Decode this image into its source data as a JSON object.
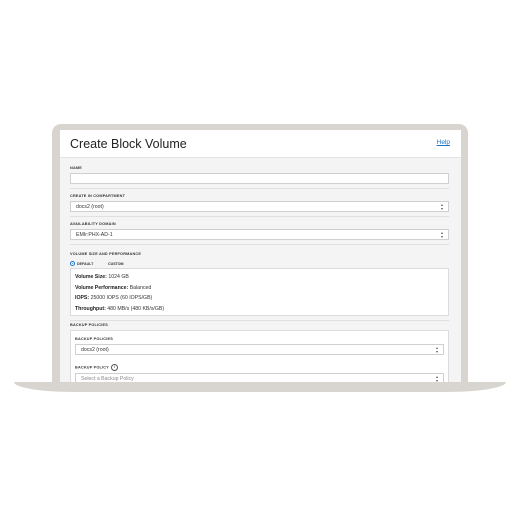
{
  "dialog": {
    "title": "Create Block Volume",
    "help_label": "Help"
  },
  "fields": {
    "name": {
      "label": "NAME",
      "value": ""
    },
    "compartment": {
      "label": "CREATE IN COMPARTMENT",
      "value": "docs2 (root)"
    },
    "availability_domain": {
      "label": "AVAILABILITY DOMAIN",
      "value": "EMIr:PHX-AD-1"
    }
  },
  "volume": {
    "section_label": "VOLUME SIZE AND PERFORMANCE",
    "options": [
      {
        "label": "DEFAULT",
        "selected": true
      },
      {
        "label": "CUSTOM",
        "selected": false
      }
    ],
    "size_label": "Volume Size:",
    "size_value": "1024 GB",
    "performance_label": "Volume Performance:",
    "performance_value": "Balanced",
    "iops_label": "IOPS:",
    "iops_value": "25000 IOPS (60 IOPS/GB)",
    "throughput_label": "Throughput:",
    "throughput_value": "480 MB/s (480 KB/s/GB)"
  },
  "backup": {
    "section_label": "BACKUP POLICIES",
    "compartment_label": "BACKUP POLICIES",
    "compartment_value": "docs2 (root)",
    "policy_label": "BACKUP POLICY",
    "policy_placeholder": "Select a Backup Policy"
  },
  "colors": {
    "accent": "#1a73c8",
    "frame": "#d8d4cf"
  },
  "icons": {
    "select": "chevron-updown-icon",
    "info": "info-icon"
  }
}
